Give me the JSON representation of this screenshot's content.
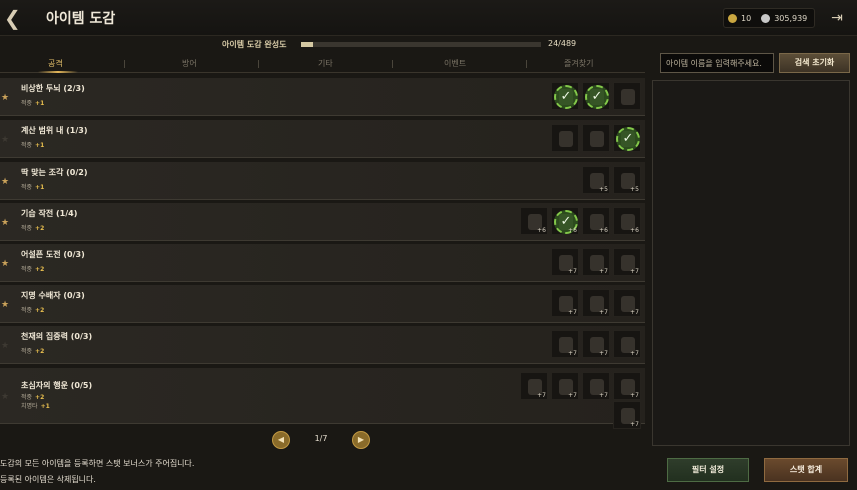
{
  "header": {
    "title": "아이템 도감",
    "gold": "10",
    "gems": "305,939"
  },
  "progress": {
    "label": "아이템 도감 완성도",
    "count": "24/489",
    "fraction": 0.049
  },
  "tabs": [
    "공격",
    "방어",
    "기타",
    "이벤트",
    "즐겨찾기"
  ],
  "search": {
    "placeholder": "아이템 이름을 입력해주세요.",
    "reset_label": "검색 초기화"
  },
  "sets": [
    {
      "name": "비상한 두뇌 (2/3)",
      "starred": true,
      "stats": [
        {
          "label": "적중",
          "value": "+1"
        }
      ],
      "slots": [
        {
          "checked": true,
          "plus": ""
        },
        {
          "checked": true,
          "plus": ""
        },
        {
          "checked": false,
          "plus": ""
        }
      ]
    },
    {
      "name": "계산 범위 내 (1/3)",
      "starred": false,
      "stats": [
        {
          "label": "적중",
          "value": "+1"
        }
      ],
      "slots": [
        {
          "checked": false,
          "plus": ""
        },
        {
          "checked": false,
          "plus": ""
        },
        {
          "checked": true,
          "plus": ""
        }
      ]
    },
    {
      "name": "딱 맞는 조각 (0/2)",
      "starred": true,
      "stats": [
        {
          "label": "적중",
          "value": "+1"
        }
      ],
      "slots": [
        {
          "checked": false,
          "plus": "+5"
        },
        {
          "checked": false,
          "plus": "+5"
        }
      ]
    },
    {
      "name": "기습 작전 (1/4)",
      "starred": true,
      "stats": [
        {
          "label": "적중",
          "value": "+2"
        }
      ],
      "slots": [
        {
          "checked": false,
          "plus": "+6"
        },
        {
          "checked": true,
          "plus": "+6"
        },
        {
          "checked": false,
          "plus": "+6"
        },
        {
          "checked": false,
          "plus": "+6"
        }
      ]
    },
    {
      "name": "어설픈 도전 (0/3)",
      "starred": true,
      "stats": [
        {
          "label": "적중",
          "value": "+2"
        }
      ],
      "slots": [
        {
          "checked": false,
          "plus": "+7"
        },
        {
          "checked": false,
          "plus": "+7"
        },
        {
          "checked": false,
          "plus": "+7"
        }
      ]
    },
    {
      "name": "지명 수배자 (0/3)",
      "starred": true,
      "stats": [
        {
          "label": "적중",
          "value": "+2"
        }
      ],
      "slots": [
        {
          "checked": false,
          "plus": "+7"
        },
        {
          "checked": false,
          "plus": "+7"
        },
        {
          "checked": false,
          "plus": "+7"
        }
      ]
    },
    {
      "name": "천재의 집중력 (0/3)",
      "starred": false,
      "stats": [
        {
          "label": "적중",
          "value": "+2"
        }
      ],
      "slots": [
        {
          "checked": false,
          "plus": "+7"
        },
        {
          "checked": false,
          "plus": "+7"
        },
        {
          "checked": false,
          "plus": "+7"
        }
      ]
    },
    {
      "name": "초심자의 행운 (0/5)",
      "starred": false,
      "stats": [
        {
          "label": "적중",
          "value": "+2"
        },
        {
          "label": "치명타",
          "value": "+1"
        }
      ],
      "slots": [
        {
          "checked": false,
          "plus": "+7"
        },
        {
          "checked": false,
          "plus": "+7"
        },
        {
          "checked": false,
          "plus": "+7"
        },
        {
          "checked": false,
          "plus": "+7"
        },
        {
          "checked": false,
          "plus": "+7"
        }
      ]
    }
  ],
  "pagination": {
    "text": "1/7",
    "prev_icon": "◀",
    "next_icon": "▶"
  },
  "footer": {
    "line1": "도감의 모든 아이템을 등록하면 스탯 보너스가 주어집니다.",
    "line2": "등록된 아이템은 삭제됩니다.",
    "filter_label": "필터 설정",
    "sum_label": "스탯 합계"
  },
  "icons": {
    "back": "chevron-back-icon",
    "exit": "exit-icon",
    "gold": "gold-coin-icon",
    "gem": "gem-icon",
    "star": "star-icon"
  },
  "colors": {
    "accent_gold": "#e8bf4f",
    "check_green": "#83c84a",
    "tab_active": "#e9c46c"
  }
}
